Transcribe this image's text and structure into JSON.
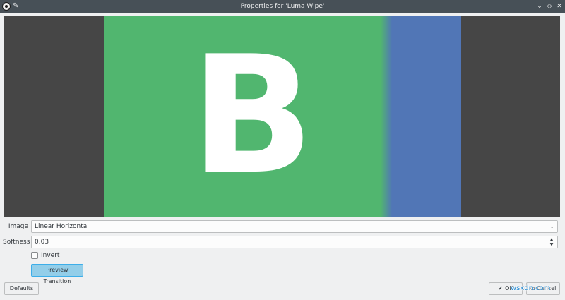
{
  "window": {
    "title": "Properties for 'Luma Wipe'",
    "app_icon": "obs-logo-icon",
    "pin_icon": "pin-icon",
    "pin_glyph": "✎",
    "minimize_glyph": "⌄",
    "maximize_glyph": "◇",
    "close_glyph": "✕"
  },
  "preview": {
    "letter": "B",
    "colors": {
      "background": "#464646",
      "left": "#51b66f",
      "right": "#5176b6"
    }
  },
  "form": {
    "image_label": "Image",
    "image_value": "Linear Horizontal",
    "combo_arrow": "⌄",
    "softness_label": "Softness",
    "softness_value": "0.03",
    "spin_up": "▲",
    "spin_down": "▼",
    "invert_label": "Invert",
    "invert_checked": false,
    "preview_button": "Preview Transition"
  },
  "footer": {
    "defaults_label": "Defaults",
    "ok_icon": "✔",
    "ok_label": "OK",
    "cancel_icon": "⊘",
    "cancel_label": "Cancel",
    "watermark": "wsxdn.com"
  }
}
